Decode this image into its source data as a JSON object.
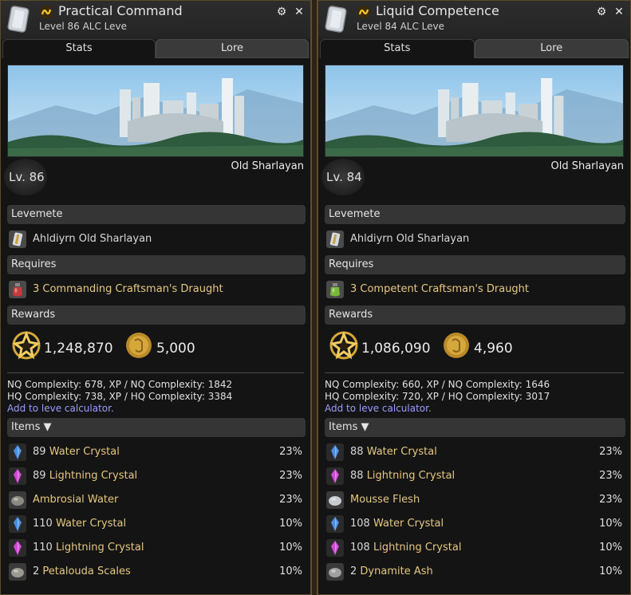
{
  "panels": [
    {
      "title": "Practical Command",
      "subtitle": "Level 86 ALC Leve",
      "tabs": [
        "Stats",
        "Lore"
      ],
      "location": "Old Sharlayan",
      "level_badge": "Lv. 86",
      "sections": {
        "levemete": "Levemete",
        "requires": "Requires",
        "rewards": "Rewards",
        "items": "Items ▼"
      },
      "levemete_name": "Ahldiyrn Old Sharlayan",
      "requires_item": "3 Commanding Craftsman's Draught",
      "requires_icon": "red-potion-icon",
      "reward_xp": "1,248,870",
      "reward_gil": "5,000",
      "nq_line": "NQ Complexity: 678, XP / NQ Complexity: 1842",
      "hq_line": "HQ Complexity: 738, XP / HQ Complexity: 3384",
      "calc_link": "Add to leve calculator.",
      "items": [
        {
          "qty": "89",
          "name": "Water Crystal",
          "pct": "23%",
          "icon": "water-crystal-icon",
          "color": "#4a8fe0"
        },
        {
          "qty": "89",
          "name": "Lightning Crystal",
          "pct": "23%",
          "icon": "lightning-crystal-icon",
          "color": "#d04ad8"
        },
        {
          "qty": "",
          "name": "Ambrosial Water",
          "pct": "23%",
          "icon": "ambrosial-water-icon",
          "color": "#8a8a80"
        },
        {
          "qty": "110",
          "name": "Water Crystal",
          "pct": "10%",
          "icon": "water-crystal-icon",
          "color": "#4a8fe0"
        },
        {
          "qty": "110",
          "name": "Lightning Crystal",
          "pct": "10%",
          "icon": "lightning-crystal-icon",
          "color": "#d04ad8"
        },
        {
          "qty": "2",
          "name": "Petalouda Scales",
          "pct": "10%",
          "icon": "petalouda-scales-icon",
          "color": "#9a9a90"
        }
      ]
    },
    {
      "title": "Liquid Competence",
      "subtitle": "Level 84 ALC Leve",
      "tabs": [
        "Stats",
        "Lore"
      ],
      "location": "Old Sharlayan",
      "level_badge": "Lv. 84",
      "sections": {
        "levemete": "Levemete",
        "requires": "Requires",
        "rewards": "Rewards",
        "items": "Items ▼"
      },
      "levemete_name": "Ahldiyrn Old Sharlayan",
      "requires_item": "3 Competent Craftsman's Draught",
      "requires_icon": "green-potion-icon",
      "reward_xp": "1,086,090",
      "reward_gil": "4,960",
      "nq_line": "NQ Complexity: 660, XP / NQ Complexity: 1646",
      "hq_line": "HQ Complexity: 720, XP / HQ Complexity: 3017",
      "calc_link": "Add to leve calculator.",
      "items": [
        {
          "qty": "88",
          "name": "Water Crystal",
          "pct": "23%",
          "icon": "water-crystal-icon",
          "color": "#4a8fe0"
        },
        {
          "qty": "88",
          "name": "Lightning Crystal",
          "pct": "23%",
          "icon": "lightning-crystal-icon",
          "color": "#d04ad8"
        },
        {
          "qty": "",
          "name": "Mousse Flesh",
          "pct": "23%",
          "icon": "mousse-flesh-icon",
          "color": "#c8ccd0"
        },
        {
          "qty": "108",
          "name": "Water Crystal",
          "pct": "10%",
          "icon": "water-crystal-icon",
          "color": "#4a8fe0"
        },
        {
          "qty": "108",
          "name": "Lightning Crystal",
          "pct": "10%",
          "icon": "lightning-crystal-icon",
          "color": "#d04ad8"
        },
        {
          "qty": "2",
          "name": "Dynamite Ash",
          "pct": "10%",
          "icon": "dynamite-ash-icon",
          "color": "#a0a0a0"
        }
      ]
    }
  ]
}
